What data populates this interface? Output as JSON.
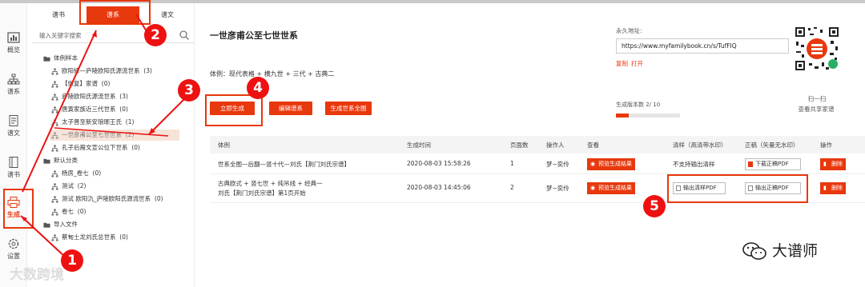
{
  "nav": [
    {
      "label": "概览",
      "icon": "bar-chart-icon"
    },
    {
      "label": "谱系",
      "icon": "org-chart-icon"
    },
    {
      "label": "谱文",
      "icon": "document-icon"
    },
    {
      "label": "谱书",
      "icon": "book-icon"
    },
    {
      "label": "生成",
      "icon": "printer-icon"
    },
    {
      "label": "设置",
      "icon": "gear-icon"
    }
  ],
  "tree": {
    "tabs": [
      "谱书",
      "谱系",
      "谱文"
    ],
    "search_placeholder": "输入关键字搜索",
    "groups": [
      {
        "label": "体例样本",
        "items": [
          {
            "label": "欧阳修—庐陵欧阳氏源流世系",
            "count": "(3)"
          },
          {
            "label": "【恢复】家谱",
            "count": "(0)"
          },
          {
            "label": "庐陵欧阳氏源流世系",
            "count": "(3)"
          },
          {
            "label": "唐寅家族近三代世系",
            "count": "(0)"
          },
          {
            "label": "太子晋至新安琅琊王氏",
            "count": "(1)"
          },
          {
            "label": "一世彦甫公至七世世系",
            "count": "(2)"
          },
          {
            "label": "孔子后裔文宣公位下世系",
            "count": "(0)"
          }
        ]
      },
      {
        "label": "默认分类",
        "items": [
          {
            "label": "杨房_卷七",
            "count": "(0)"
          },
          {
            "label": "测试",
            "count": "(2)"
          },
          {
            "label": "测试 欧阳氿_庐陵欧阳氏源流世系",
            "count": "(0)"
          },
          {
            "label": "卷七",
            "count": "(0)"
          }
        ]
      },
      {
        "label": "导入文件",
        "items": [
          {
            "label": "蔡甸土龙刘氏总世系",
            "count": "(0)"
          }
        ]
      }
    ]
  },
  "main": {
    "title": "一世彦甫公至七世世系",
    "meta": "体例：现代表格 + 横九世 + 三代 + 古典二",
    "buttons": [
      "立即生成",
      "编辑谱系",
      "生成世系全图"
    ],
    "perm_label": "永久地址:",
    "perm_url": "https://www.myfamilybook.cn/s/TufFIQ",
    "copy": "复制",
    "open": "打开",
    "version": "生成版本数  2/ 10",
    "version_fraction": 0.2,
    "qr_caption1": "扫一扫",
    "qr_caption2": "查看共享家谱"
  },
  "table": {
    "headers": [
      "体例",
      "生成时间",
      "页面数",
      "操作人",
      "查看",
      "清样（高清带水印）",
      "正稿（矢量无水印）",
      "操作"
    ],
    "rows": [
      {
        "style1": "世系全图—后翻—竖十代—刘氏【荆门刘氏宗谱】",
        "style2": "",
        "time": "2020-08-03 15:58:26",
        "pages": "1",
        "op": "梦~奕伶",
        "view": "预览生成结果",
        "proof": "不支持输出清样",
        "final": "下载正稿PDF",
        "del": "删除"
      },
      {
        "style1": "古典欧式 + 竖七世 + 纯吊线 + 经典一",
        "style2": "刘氏【荆门刘氏宗谱】第1页开始",
        "time": "2020-08-03 14:45:06",
        "pages": "2",
        "op": "梦~奕伶",
        "view": "预览生成结果",
        "proof": "输出清样PDF",
        "final": "输出正稿PDF",
        "del": "删除"
      }
    ]
  },
  "annotations": [
    "1",
    "2",
    "3",
    "4",
    "5"
  ],
  "watermark_left": "大数跨境",
  "watermark_right": "大谱师",
  "colors": {
    "accent": "#e8380d",
    "annot": "#e11"
  }
}
